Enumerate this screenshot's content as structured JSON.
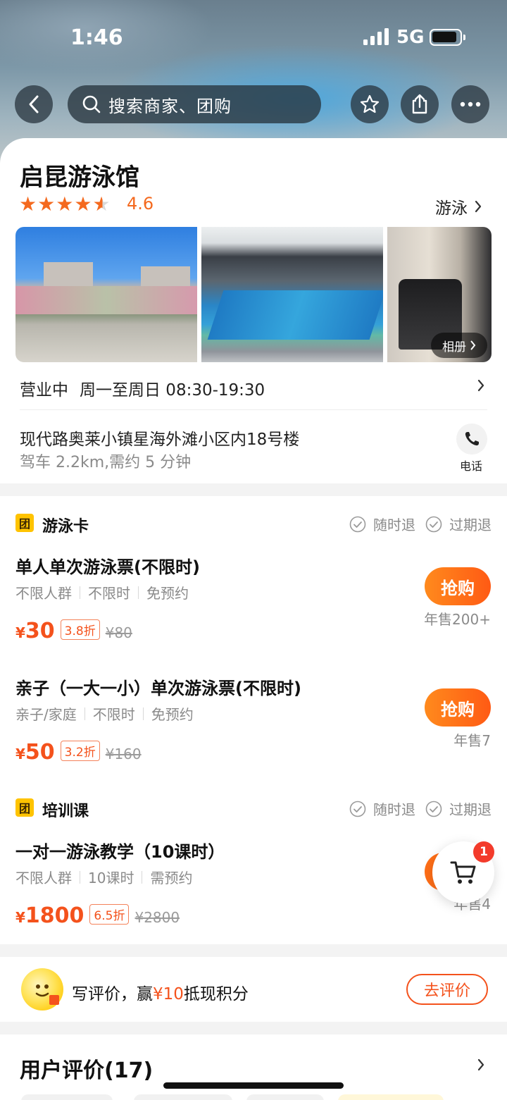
{
  "status_bar": {
    "time": "1:46",
    "network": "5G"
  },
  "header": {
    "search_placeholder": "搜索商家、团购"
  },
  "shop": {
    "name": "启昆游泳馆",
    "rating": "4.6",
    "stars": 4.5,
    "category": "游泳",
    "album_label": "相册",
    "business_status": "营业中",
    "hours": "周一至周日 08:30-19:30",
    "address": "现代路奥莱小镇星海外滩小区内18号楼",
    "drive_info": "驾车 2.2km,需约 5 分钟",
    "phone_label": "电话"
  },
  "sections": [
    {
      "title": "游泳卡",
      "badge": "团",
      "policies": [
        "随时退",
        "过期退"
      ],
      "deals": [
        {
          "title": "单人单次游泳票(不限时)",
          "tags": [
            "不限人群",
            "不限时",
            "免预约"
          ],
          "currency": "¥",
          "price": "30",
          "discount": "3.8折",
          "original": "¥80",
          "buy_label": "抢购",
          "sold": "年售200+"
        },
        {
          "title": "亲子（一大一小）单次游泳票(不限时)",
          "tags": [
            "亲子/家庭",
            "不限时",
            "免预约"
          ],
          "currency": "¥",
          "price": "50",
          "discount": "3.2折",
          "original": "¥160",
          "buy_label": "抢购",
          "sold": "年售7"
        }
      ]
    },
    {
      "title": "培训课",
      "badge": "团",
      "policies": [
        "随时退",
        "过期退"
      ],
      "deals": [
        {
          "title": "一对一游泳教学（10课时）",
          "tags": [
            "不限人群",
            "10课时",
            "需预约"
          ],
          "currency": "¥",
          "price": "1800",
          "discount": "6.5折",
          "original": "¥2800",
          "sold": "年售4"
        }
      ]
    }
  ],
  "cart": {
    "count": "1"
  },
  "review_promo": {
    "text_before": "写评价，赢",
    "highlight": "¥10",
    "text_after": "抵现积分",
    "button": "去评价"
  },
  "reviews": {
    "title": "用户评价(17)"
  },
  "colors": {
    "accent": "#f4521c",
    "star": "#f4691e",
    "badge": "#ffc300"
  }
}
